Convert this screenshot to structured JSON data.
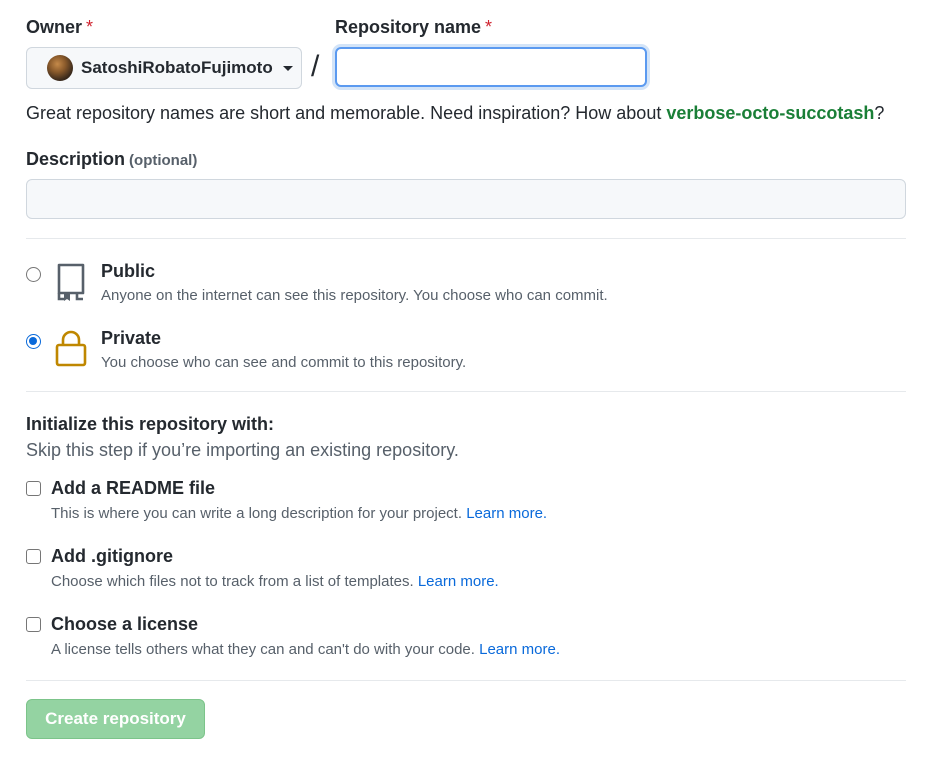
{
  "owner": {
    "label": "Owner",
    "required_mark": "*",
    "selected": "SatoshiRobatoFujimoto"
  },
  "separator": "/",
  "repo_name": {
    "label": "Repository name",
    "required_mark": "*",
    "value": "",
    "placeholder": ""
  },
  "hint": {
    "text": "Great repository names are short and memorable. Need inspiration? How about ",
    "suggestion": "verbose-octo-succotash",
    "suffix": "?"
  },
  "description": {
    "label": "Description",
    "optional": "(optional)",
    "value": ""
  },
  "visibility": {
    "selected": "private",
    "options": [
      {
        "id": "public",
        "title": "Public",
        "desc": "Anyone on the internet can see this repository. You choose who can commit.",
        "icon": "repo-icon"
      },
      {
        "id": "private",
        "title": "Private",
        "desc": "You choose who can see and commit to this repository.",
        "icon": "lock-icon"
      }
    ]
  },
  "initialize": {
    "title": "Initialize this repository with:",
    "subtitle": "Skip this step if you’re importing an existing repository.",
    "options": [
      {
        "title": "Add a README file",
        "desc": "This is where you can write a long description for your project.",
        "link": "Learn more.",
        "checked": false
      },
      {
        "title": "Add .gitignore",
        "desc": "Choose which files not to track from a list of templates.",
        "link": "Learn more.",
        "checked": false
      },
      {
        "title": "Choose a license",
        "desc": "A license tells others what they can and can't do with your code.",
        "link": "Learn more.",
        "checked": false
      }
    ]
  },
  "create_button": {
    "label": "Create repository",
    "disabled": true
  },
  "colors": {
    "accent": "#0969da",
    "success": "#1a7f37",
    "lock": "#bf8700",
    "disabled_button": "#94d3a2"
  }
}
